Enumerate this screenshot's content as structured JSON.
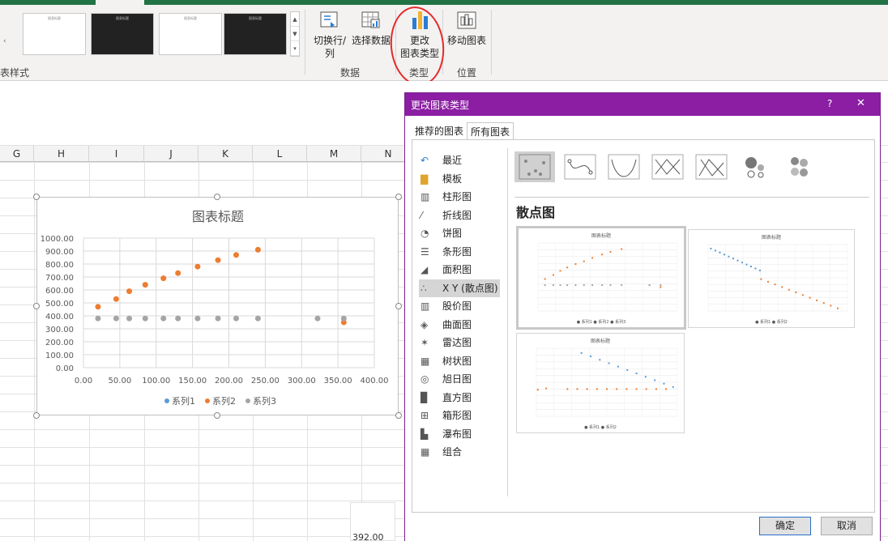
{
  "ribbon": {
    "group_left_label": "表样式",
    "switch_row_col": "切换行/列",
    "select_data": "选择数据",
    "change_type_line1": "更改",
    "change_type_line2": "图表类型",
    "move_chart": "移动图表",
    "group_data": "数据",
    "group_type": "类型",
    "group_location": "位置"
  },
  "columns": [
    "G",
    "H",
    "I",
    "J",
    "K",
    "L",
    "M",
    "N"
  ],
  "cell_value": "392.00",
  "chart": {
    "title": "图表标题",
    "legend": [
      "系列1",
      "系列2",
      "系列3"
    ]
  },
  "chart_data": {
    "type": "scatter",
    "title": "图表标题",
    "xlim": [
      0,
      400
    ],
    "ylim": [
      0,
      1000
    ],
    "x_ticks": [
      "0.00",
      "50.00",
      "100.00",
      "150.00",
      "200.00",
      "250.00",
      "300.00",
      "350.00",
      "400.00"
    ],
    "y_ticks": [
      "0.00",
      "100.00",
      "200.00",
      "300.00",
      "400.00",
      "500.00",
      "600.00",
      "700.00",
      "800.00",
      "900.00",
      "1000.00"
    ],
    "series": [
      {
        "name": "系列2",
        "color": "#ed7d31",
        "x": [
          20,
          45,
          63,
          85,
          110,
          130,
          157,
          185,
          210,
          240,
          358
        ],
        "y": [
          470,
          530,
          590,
          640,
          690,
          730,
          780,
          830,
          870,
          910,
          350
        ]
      },
      {
        "name": "系列3",
        "color": "#a5a5a5",
        "x": [
          20,
          45,
          63,
          85,
          110,
          130,
          157,
          185,
          210,
          240,
          322,
          358
        ],
        "y": [
          380,
          380,
          380,
          380,
          380,
          380,
          380,
          380,
          380,
          380,
          380,
          380
        ]
      }
    ]
  },
  "dialog": {
    "title": "更改图表类型",
    "help": "?",
    "close": "✕",
    "tabs": [
      "推荐的图表",
      "所有图表"
    ],
    "nav": [
      "最近",
      "模板",
      "柱形图",
      "折线图",
      "饼图",
      "条形图",
      "面积图",
      "X Y (散点图)",
      "股价图",
      "曲面图",
      "雷达图",
      "树状图",
      "旭日图",
      "直方图",
      "箱形图",
      "瀑布图",
      "组合"
    ],
    "section_title": "散点图",
    "preview_title": "图表标题",
    "preview_legend_a": "● 系列1  ● 系列2  ● 系列3",
    "preview_legend_b": "● 系列1  ● 系列2",
    "ok": "确定",
    "cancel": "取消"
  },
  "colors": {
    "accent": "#8b1ea3",
    "excel_green": "#217346",
    "orange": "#ed7d31",
    "gray": "#a5a5a5",
    "blue": "#5b9bd5"
  }
}
